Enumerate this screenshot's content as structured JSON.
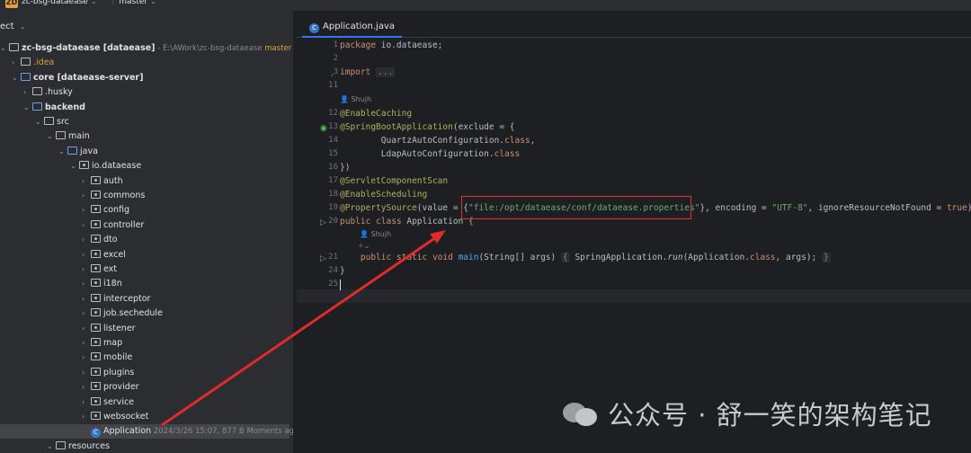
{
  "topbar": {
    "project_badge": "ZD",
    "project_name": "zc-bsg-dataease",
    "branch": "master"
  },
  "project_panel": {
    "header": "ect",
    "tree": [
      {
        "depth": 0,
        "arrow": "v",
        "icon": "folder",
        "label": "zc-bsg-dataease [dataease]",
        "extra": " - E:\\AWork\\zc-bsg-dataease",
        "branch": " master / ø",
        "bold": true
      },
      {
        "depth": 1,
        "arrow": ">",
        "icon": "folder",
        "label": ".idea",
        "orange": true
      },
      {
        "depth": 1,
        "arrow": "v",
        "icon": "folder-blue",
        "label": "core [dataease-server]",
        "bold": true
      },
      {
        "depth": 2,
        "arrow": ">",
        "icon": "folder",
        "label": ".husky"
      },
      {
        "depth": 2,
        "arrow": "v",
        "icon": "folder-blue",
        "label": "backend",
        "bold": true
      },
      {
        "depth": 3,
        "arrow": "v",
        "icon": "folder",
        "label": "src"
      },
      {
        "depth": 4,
        "arrow": "v",
        "icon": "folder",
        "label": "main"
      },
      {
        "depth": 5,
        "arrow": "v",
        "icon": "folder-blue",
        "label": "java"
      },
      {
        "depth": 6,
        "arrow": "v",
        "icon": "package",
        "label": "io.dataease"
      },
      {
        "depth": 7,
        "arrow": ">",
        "icon": "package",
        "label": "auth"
      },
      {
        "depth": 7,
        "arrow": ">",
        "icon": "package",
        "label": "commons"
      },
      {
        "depth": 7,
        "arrow": ">",
        "icon": "package",
        "label": "config"
      },
      {
        "depth": 7,
        "arrow": ">",
        "icon": "package",
        "label": "controller"
      },
      {
        "depth": 7,
        "arrow": ">",
        "icon": "package",
        "label": "dto"
      },
      {
        "depth": 7,
        "arrow": ">",
        "icon": "package",
        "label": "excel"
      },
      {
        "depth": 7,
        "arrow": ">",
        "icon": "package",
        "label": "ext"
      },
      {
        "depth": 7,
        "arrow": ">",
        "icon": "package",
        "label": "i18n"
      },
      {
        "depth": 7,
        "arrow": ">",
        "icon": "package",
        "label": "interceptor"
      },
      {
        "depth": 7,
        "arrow": ">",
        "icon": "package",
        "label": "job.sechedule"
      },
      {
        "depth": 7,
        "arrow": ">",
        "icon": "package",
        "label": "listener"
      },
      {
        "depth": 7,
        "arrow": ">",
        "icon": "package",
        "label": "map"
      },
      {
        "depth": 7,
        "arrow": ">",
        "icon": "package",
        "label": "mobile"
      },
      {
        "depth": 7,
        "arrow": ">",
        "icon": "package",
        "label": "plugins"
      },
      {
        "depth": 7,
        "arrow": ">",
        "icon": "package",
        "label": "provider"
      },
      {
        "depth": 7,
        "arrow": ">",
        "icon": "package",
        "label": "service"
      },
      {
        "depth": 7,
        "arrow": ">",
        "icon": "package",
        "label": "websocket"
      },
      {
        "depth": 7,
        "arrow": "",
        "icon": "class",
        "label": "Application",
        "extra": "  2024/3/26 15:07, 877 B Moments ago",
        "selected": true
      },
      {
        "depth": 4,
        "arrow": "v",
        "icon": "folder",
        "label": "resources"
      }
    ]
  },
  "editor": {
    "tab_label": "Application.java",
    "line_numbers": [
      "1",
      "2",
      "3",
      "11",
      "",
      "12",
      "13",
      "14",
      "15",
      "16",
      "17",
      "18",
      "19",
      "20",
      "",
      "",
      "21",
      "24",
      "25"
    ],
    "author_hint": "Shujh",
    "code": {
      "l1_kw": "package",
      "l1_rest": " io.dataease;",
      "l3_kw": "import",
      "l3_fold": "...",
      "l12": "@EnableCaching",
      "l13_ann": "@SpringBootApplication",
      "l13_rest": "(exclude = {",
      "l14_a": "        QuartzAutoConfiguration.",
      "l14_kw": "class",
      "l14_b": ",",
      "l15_a": "        LdapAutoConfiguration.",
      "l15_kw": "class",
      "l16": "})",
      "l17": "@ServletComponentScan",
      "l18": "@EnableScheduling",
      "l19_ann": "@PropertySource",
      "l19_a": "(value = {",
      "l19_str": "\"file:/opt/dataease/conf/dataease.properties\"",
      "l19_b": "}, encoding = ",
      "l19_str2": "\"UTF-8\"",
      "l19_c": ", ignoreResourceNotFound = ",
      "l19_kw": "true",
      "l19_d": ")",
      "l20_kw": "public class",
      "l20_name": " Application ",
      "l20_brace": "{",
      "l21_kw": "    public static void",
      "l21_fn": " main",
      "l21_a": "(String[] args)",
      "l21_fold": "{",
      "l21_b": " SpringApplication.",
      "l21_run": "run",
      "l21_c": "(Application.",
      "l21_kw2": "class",
      "l21_d": ", args); ",
      "l21_fold2": "}",
      "l24": "}"
    }
  },
  "watermark": {
    "text": "公众号 · 舒一笑的架构笔记"
  },
  "colors": {
    "highlight_box": "#e03535",
    "arrow": "#e02b2b",
    "accent": "#3574f0"
  }
}
